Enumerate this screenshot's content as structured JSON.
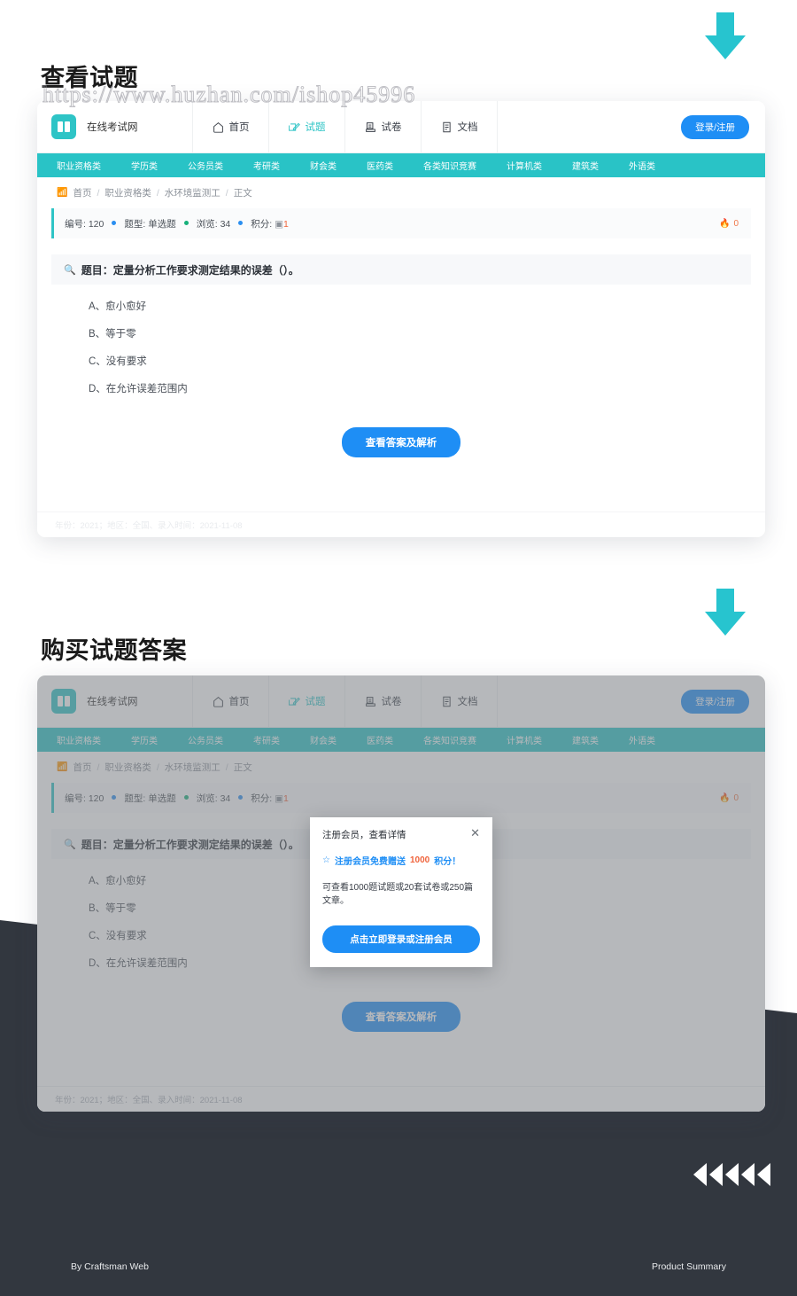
{
  "sections": {
    "first_heading": "查看试题",
    "second_heading": "购买试题答案",
    "watermark": "https://www.huzhan.com/ishop45996"
  },
  "site": {
    "brand_name": "在线考试网",
    "logo_icon": "book-icon",
    "login_label": "登录/注册",
    "nav": [
      {
        "label": "首页",
        "icon": "home-icon",
        "active": false
      },
      {
        "label": "试题",
        "icon": "edit-square-icon",
        "active": true
      },
      {
        "label": "试卷",
        "icon": "paper-stack-icon",
        "active": false
      },
      {
        "label": "文档",
        "icon": "document-icon",
        "active": false
      }
    ],
    "categories": [
      "职业资格类",
      "学历类",
      "公务员类",
      "考研类",
      "财会类",
      "医药类",
      "各类知识竞赛",
      "计算机类",
      "建筑类",
      "外语类"
    ],
    "accent_teal": "#29c3c6",
    "accent_blue": "#1e8ef5"
  },
  "breadcrumb": {
    "rss_icon": "rss-icon",
    "items": [
      "首页",
      "职业资格类",
      "水环境监测工",
      "正文"
    ],
    "separator": "/"
  },
  "meta": {
    "id_label": "编号:",
    "id_value": "120",
    "type_label": "题型:",
    "type_value": "单选题",
    "views_label": "浏览:",
    "views_value": "34",
    "points_label": "积分:",
    "points_icon": "coin-icon",
    "points_value": "1",
    "hot_icon": "flame-icon",
    "hot_value": "0"
  },
  "question": {
    "search_icon": "magnifier-icon",
    "prompt": "题目：定量分析工作要求测定结果的误差（）。",
    "options": [
      "A、愈小愈好",
      "B、等于零",
      "C、没有要求",
      "D、在允许误差范围内"
    ],
    "cta_label": "查看答案及解析"
  },
  "card_footer": "年份：2021；地区：全国、录入时间：2021-11-08",
  "modal": {
    "title": "注册会员，查看详情",
    "close_icon": "close-icon",
    "promo_icon": "sparkle-icon",
    "promo_prefix": "注册会员免费赠送",
    "promo_number": "1000",
    "promo_suffix": "积分！",
    "description": "可查看1000题试题或20套试卷或250篇文章。",
    "button_label": "点击立即登录或注册会员"
  },
  "footer": {
    "left": "By Craftsman Web",
    "right": "Product Summary"
  }
}
